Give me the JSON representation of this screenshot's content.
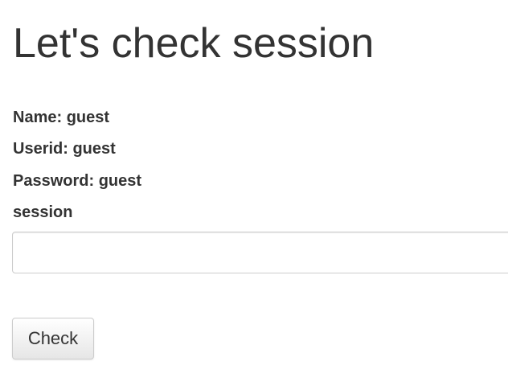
{
  "page": {
    "title": "Let's check session"
  },
  "info": {
    "name": "Name: guest",
    "userid": "Userid: guest",
    "password": "Password: guest"
  },
  "session": {
    "label": "session",
    "value": "",
    "placeholder": ""
  },
  "actions": {
    "check_label": "Check"
  }
}
